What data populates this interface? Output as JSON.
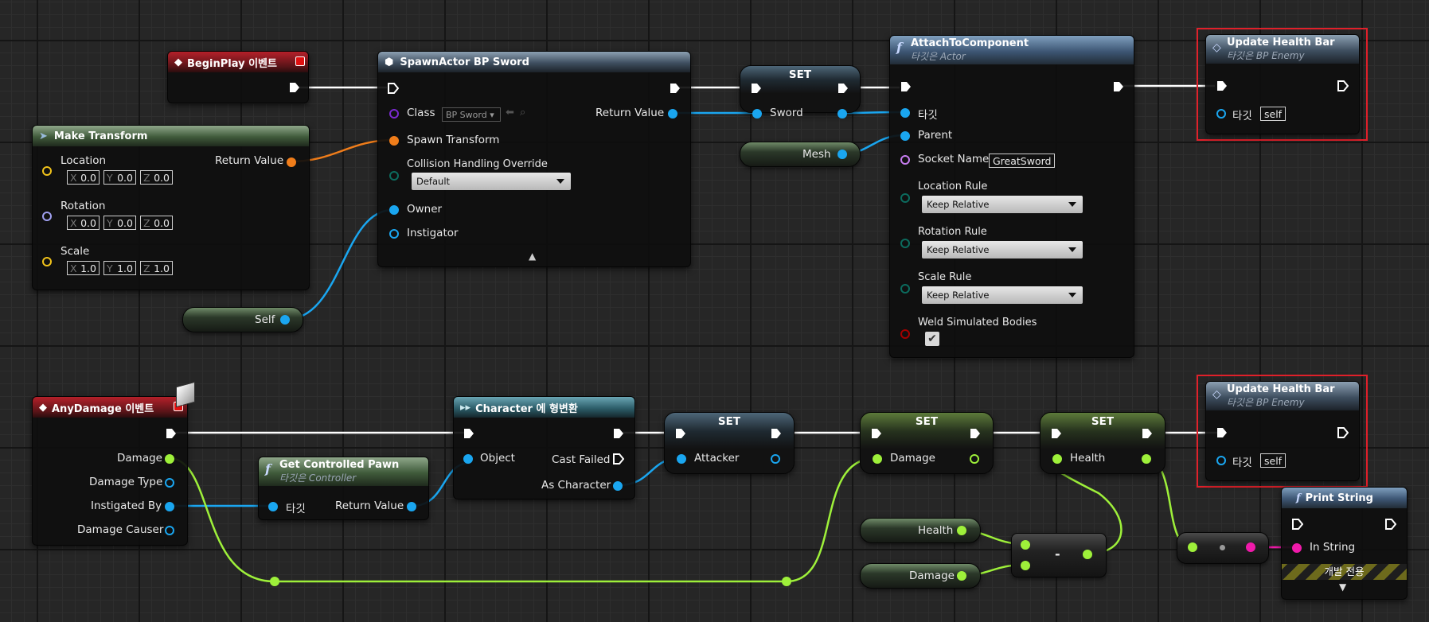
{
  "nodes": {
    "beginplay": {
      "title": "BeginPlay 이벤트"
    },
    "spawnactor": {
      "title": "SpawnActor BP Sword",
      "class_label": "Class",
      "class_value": "BP Sword",
      "return_value": "Return Value",
      "spawn_transform": "Spawn Transform",
      "collision_label": "Collision Handling Override",
      "collision_value": "Default",
      "owner": "Owner",
      "instigator": "Instigator"
    },
    "make_transform": {
      "title": "Make Transform",
      "location": "Location",
      "rotation": "Rotation",
      "scale": "Scale",
      "return_value": "Return Value",
      "location_vals": [
        "0.0",
        "0.0",
        "0.0"
      ],
      "rotation_vals": [
        "0.0",
        "0.0",
        "0.0"
      ],
      "scale_vals": [
        "1.0",
        "1.0",
        "1.0"
      ],
      "axes": [
        "X",
        "Y",
        "Z"
      ]
    },
    "self_var": {
      "label": "Self"
    },
    "set_sword": {
      "title": "SET",
      "var": "Sword"
    },
    "mesh_var": {
      "label": "Mesh"
    },
    "attach": {
      "title": "AttachToComponent",
      "subtitle": "타깃은 Actor",
      "target": "타깃",
      "parent": "Parent",
      "socket_label": "Socket Name",
      "socket_value": "GreatSword",
      "location_rule": "Location Rule",
      "rotation_rule": "Rotation Rule",
      "scale_rule": "Scale Rule",
      "rule_value": "Keep Relative",
      "weld": "Weld Simulated Bodies"
    },
    "update_health_1": {
      "title": "Update Health Bar",
      "subtitle": "타깃은 BP Enemy",
      "target": "타깃",
      "self_value": "self"
    },
    "anydamage": {
      "title": "AnyDamage 이벤트",
      "damage": "Damage",
      "damage_type": "Damage Type",
      "instigated_by": "Instigated By",
      "damage_causer": "Damage Causer"
    },
    "get_pawn": {
      "title": "Get Controlled Pawn",
      "subtitle": "타깃은 Controller",
      "target": "타깃",
      "return_value": "Return Value"
    },
    "cast": {
      "title": "Character 에 형변환",
      "object": "Object",
      "cast_failed": "Cast Failed",
      "as_character": "As Character"
    },
    "set_attacker": {
      "title": "SET",
      "var": "Attacker"
    },
    "set_damage": {
      "title": "SET",
      "var": "Damage"
    },
    "set_health": {
      "title": "SET",
      "var": "Health"
    },
    "health_var": {
      "label": "Health"
    },
    "damage_var": {
      "label": "Damage"
    },
    "subtract": {
      "op": "-"
    },
    "update_health_2": {
      "title": "Update Health Bar",
      "subtitle": "타깃은 BP Enemy",
      "target": "타깃",
      "self_value": "self"
    },
    "print_string": {
      "title": "Print String",
      "in_string": "In String",
      "dev_only": "개발 전용"
    }
  },
  "colors": {
    "exec": "#ffffff",
    "object": "#1aa6f0",
    "struct": "#f07d1a",
    "vector": "#f0c21a",
    "rotator": "#a0a0f0",
    "float": "#9ef03a",
    "name": "#c77df0",
    "class": "#7a2ad0",
    "string": "#f01aaa",
    "enum": "#0c6b5e",
    "bool": "#a30000",
    "highlight": "#e0202a"
  }
}
